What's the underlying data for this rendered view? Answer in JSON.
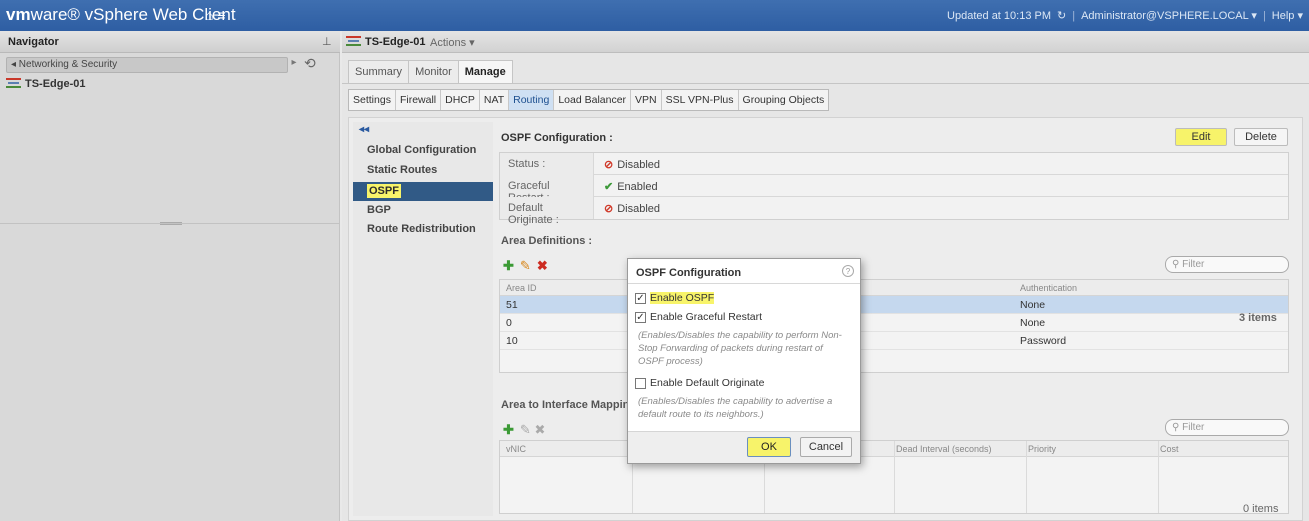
{
  "app": {
    "brand_vm": "vm",
    "brand_rest": "ware® vSphere Web Client",
    "updated": "Updated at 10:13 PM",
    "user": "Administrator@VSPHERE.LOCAL ▾",
    "help": "Help ▾"
  },
  "navigator": {
    "title": "Navigator",
    "back_label": "◂ Networking & Security",
    "item": "TS-Edge-01"
  },
  "object": {
    "title": "TS-Edge-01",
    "actions": "Actions ▾"
  },
  "main_tabs": [
    "Summary",
    "Monitor",
    "Manage"
  ],
  "sub_tabs": [
    "Settings",
    "Firewall",
    "DHCP",
    "NAT",
    "Routing",
    "Load Balancer",
    "VPN",
    "SSL VPN-Plus",
    "Grouping Objects"
  ],
  "left_menu": {
    "items": [
      "Global Configuration",
      "Static Routes",
      "OSPF",
      "BGP",
      "Route Redistribution"
    ]
  },
  "ospf_config": {
    "title": "OSPF Configuration :",
    "edit": "Edit",
    "delete": "Delete",
    "rows": [
      {
        "label": "Status :",
        "value": "Disabled",
        "state": "disabled"
      },
      {
        "label": "Graceful Restart :",
        "value": "Enabled",
        "state": "enabled"
      },
      {
        "label": "Default Originate :",
        "value": "Disabled",
        "state": "disabled"
      }
    ]
  },
  "area_definitions": {
    "title": "Area Definitions :",
    "filter_placeholder": "Filter",
    "columns": [
      "Area ID",
      "Authentication"
    ],
    "rows": [
      {
        "area_id": "51",
        "auth": "None"
      },
      {
        "area_id": "0",
        "auth": "None"
      },
      {
        "area_id": "10",
        "auth": "Password"
      }
    ],
    "count": "3 items"
  },
  "interface_mapping": {
    "title": "Area to Interface Mapping :",
    "filter_placeholder": "Filter",
    "columns": [
      "vNIC",
      "Dead Interval (seconds)",
      "Priority",
      "Cost"
    ],
    "count": "0 items"
  },
  "dialog": {
    "title": "OSPF Configuration",
    "enable_ospf": "Enable OSPF",
    "enable_graceful": "Enable Graceful Restart",
    "graceful_note": "(Enables/Disables the capability to perform Non-Stop Forwarding of packets during restart of OSPF process)",
    "enable_default": "Enable Default Originate",
    "default_note": "(Enables/Disables the capability to advertise a default route to its neighbors.)",
    "ok": "OK",
    "cancel": "Cancel"
  }
}
